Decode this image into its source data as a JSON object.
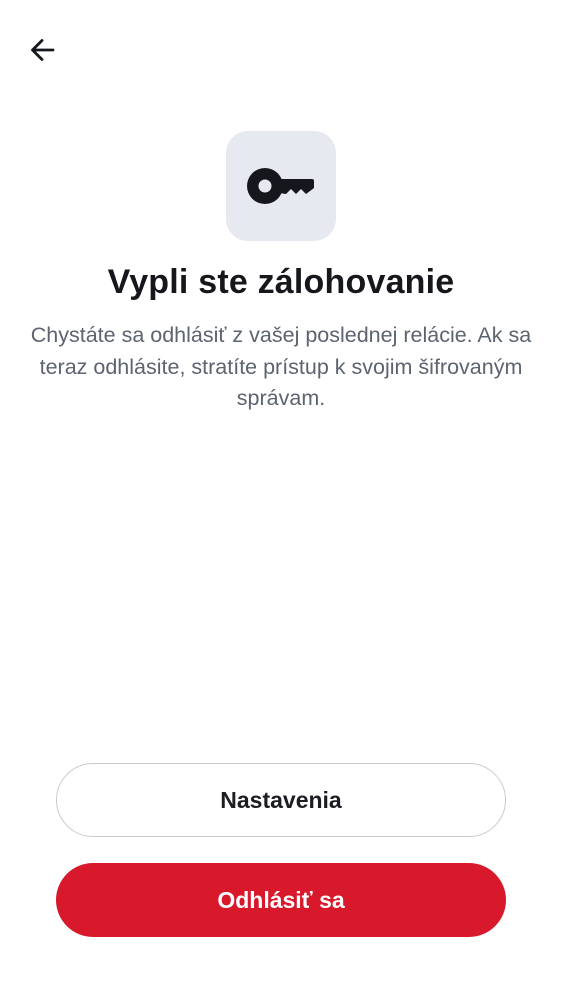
{
  "screen": {
    "title": "Vypli ste zálohovanie",
    "description": "Chystáte sa odhlásiť z vašej poslednej relácie. Ak sa teraz odhlásite, stratíte prístup k svojim šifrovaným správam."
  },
  "icons": {
    "back": "arrow-left-icon",
    "key": "key-icon"
  },
  "buttons": {
    "settings_label": "Nastavenia",
    "logout_label": "Odhlásiť sa"
  },
  "colors": {
    "primary_danger": "#d7192b",
    "icon_tile": "#e6e9f0",
    "text_primary": "#15171c",
    "text_secondary": "#5c6470"
  }
}
